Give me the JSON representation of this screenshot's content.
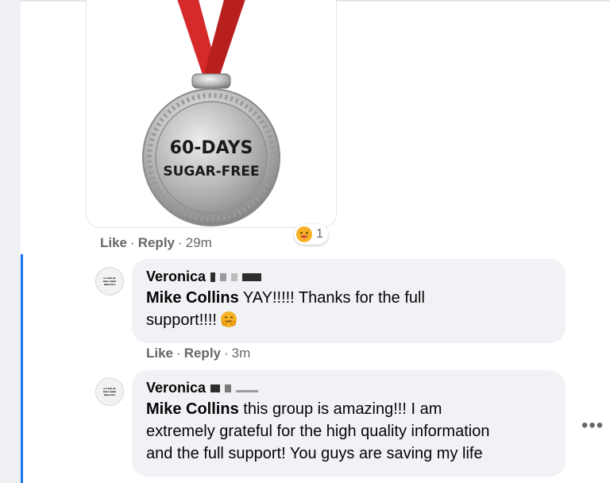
{
  "medal": {
    "line1": "60-DAYS",
    "line2": "SUGAR-FREE"
  },
  "post_meta": {
    "like": "Like",
    "reply": "Reply",
    "time": "29m",
    "reaction_count": "1"
  },
  "comments": [
    {
      "author": "Veronica",
      "mention": "Mike Collins",
      "text_line1": "YAY!!!!! Thanks for the full",
      "text_line2": "support!!!!",
      "like": "Like",
      "reply": "Reply",
      "time": "3m"
    },
    {
      "author": "Veronica",
      "mention": "Mike Collins",
      "text_line1": "this group is amazing!!! I am",
      "text_line2": "extremely grateful for the high quality information",
      "text_line3": "and the full support! You guys are saving my life"
    }
  ],
  "more_options": "•••",
  "colors": {
    "accent": "#1877f2",
    "bubble_bg": "#f0f2f5",
    "meta_text": "#65676b",
    "ribbon": "#d62a2a"
  },
  "icons": [
    "care-reaction-icon",
    "hugging-face-icon",
    "more-options-icon"
  ]
}
